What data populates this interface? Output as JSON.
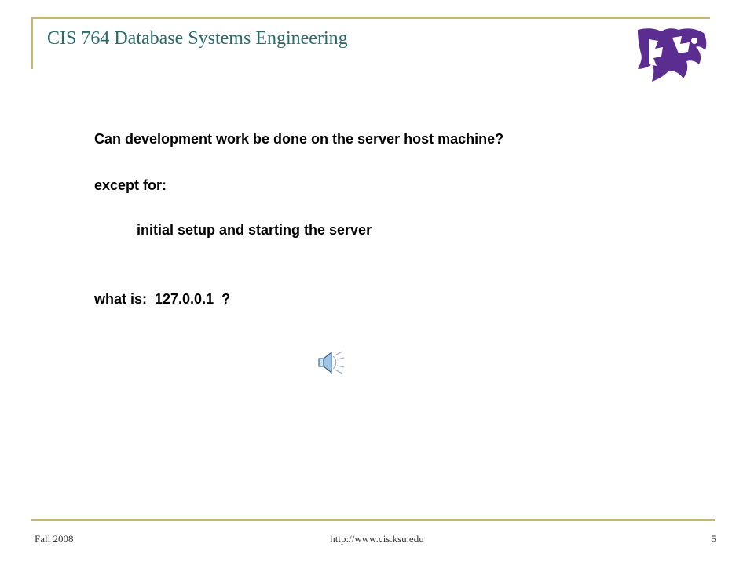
{
  "slide": {
    "title": "CIS 764 Database Systems Engineering",
    "lines": [
      "Can development work be done on the server host machine?",
      "except for:",
      "initial setup and starting the server",
      "what is:  127.0.0.1  ?"
    ]
  },
  "footer": {
    "left": "Fall 2008",
    "center": "http://www.cis.ksu.edu",
    "page_number": "5"
  },
  "icons": {
    "logo": "ksu-wildcat-logo",
    "audio": "speaker-icon"
  },
  "colors": {
    "accent_line": "#C9B46B",
    "title": "#2A6A6A",
    "logo": "#5B2D91"
  }
}
